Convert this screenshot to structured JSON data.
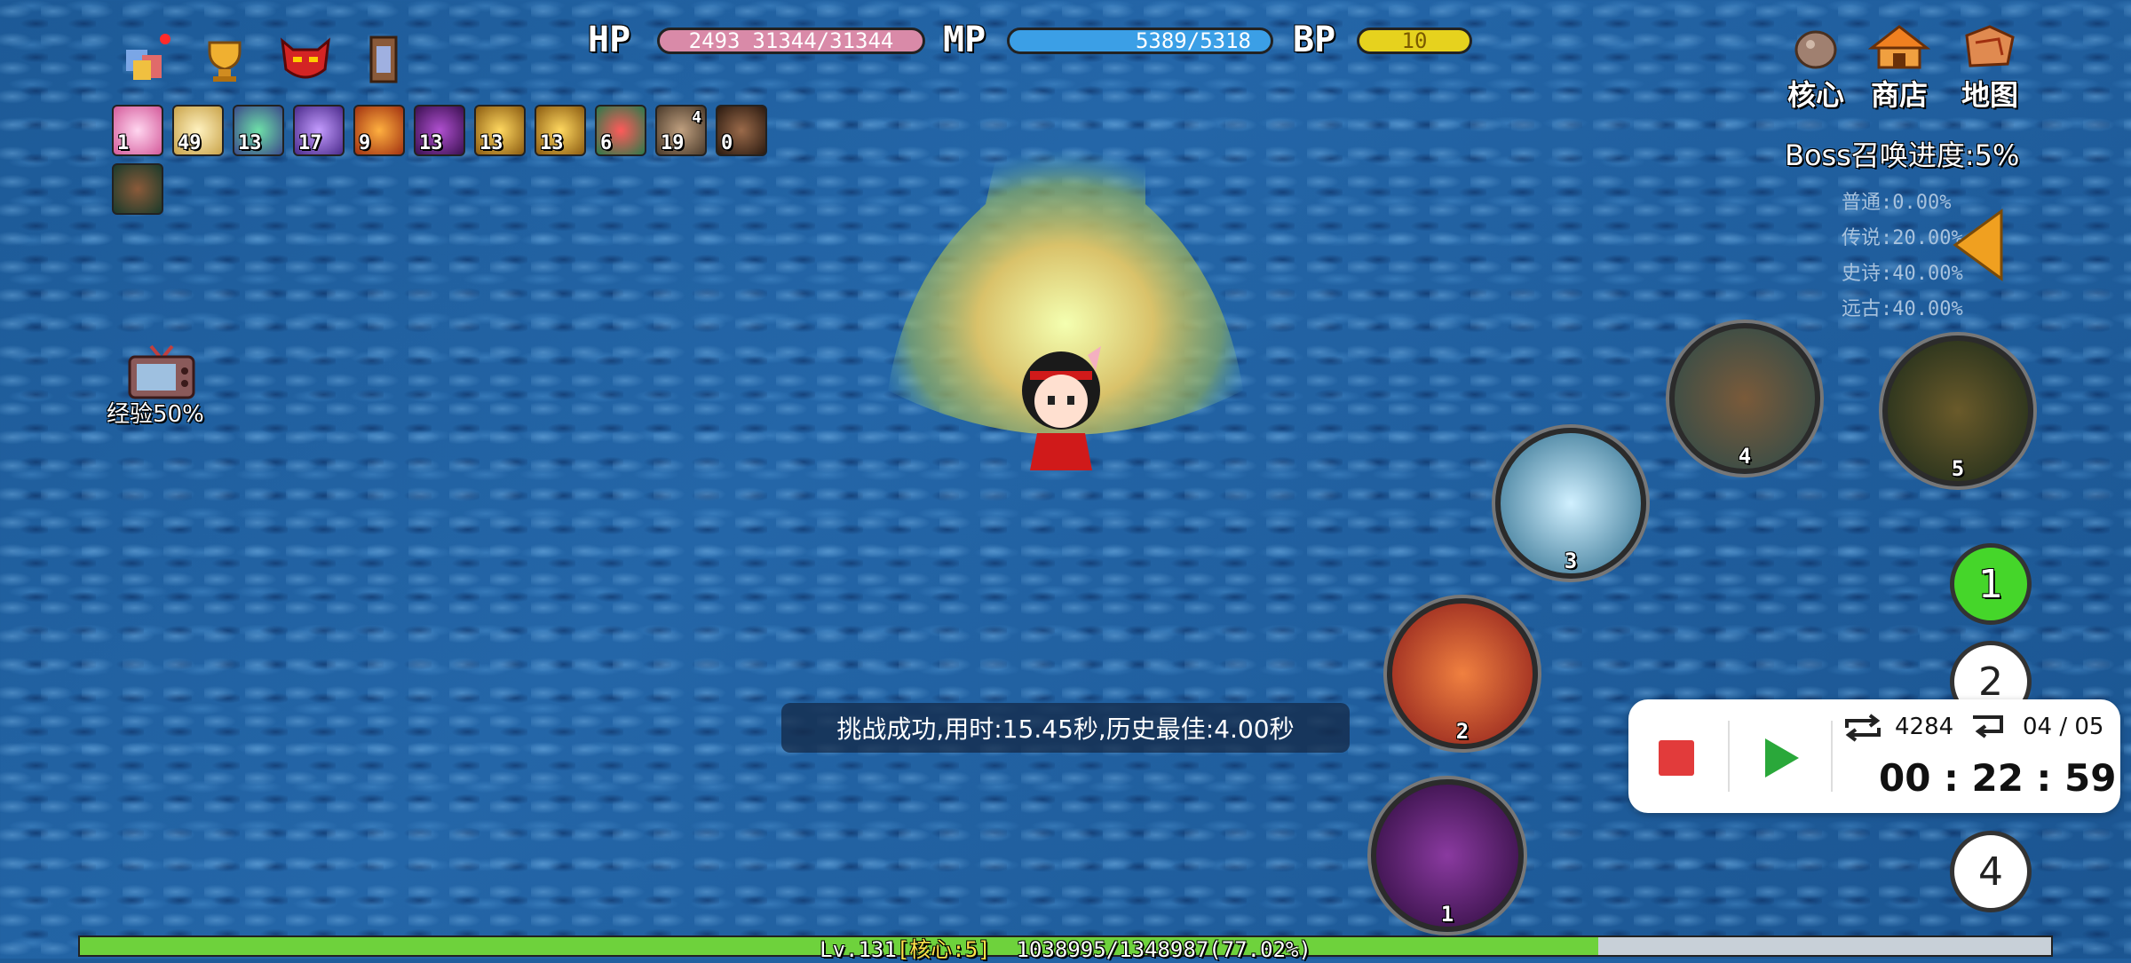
{
  "hud": {
    "hp": {
      "label": "HP",
      "prefix": "2493",
      "text": "31344/31344"
    },
    "mp": {
      "label": "MP",
      "text": "5389/5318"
    },
    "bp": {
      "label": "BP",
      "text": "10"
    }
  },
  "buffs": [
    {
      "count": "1",
      "icon": "spiral-buff-icon"
    },
    {
      "count": "49",
      "icon": "feather-buff-icon"
    },
    {
      "count": "13",
      "icon": "scales-buff-icon"
    },
    {
      "count": "17",
      "icon": "purple-wing-buff-icon"
    },
    {
      "count": "9",
      "icon": "fire-beast-buff-icon"
    },
    {
      "count": "13",
      "icon": "dark-wing-buff-icon"
    },
    {
      "count": "13",
      "icon": "gold-bell-buff-icon"
    },
    {
      "count": "13",
      "icon": "gold-bell-buff-icon"
    },
    {
      "count": "6",
      "icon": "red-flower-buff-icon"
    },
    {
      "count": "19",
      "sup": "4",
      "icon": "pickaxe-buff-icon"
    },
    {
      "count": "0",
      "icon": "werewolf-buff-icon"
    },
    {
      "count": "",
      "icon": "warrior-buff-icon"
    }
  ],
  "exp_bonus": "经验50%",
  "menu": {
    "core": "核心",
    "shop": "商店",
    "map": "地图"
  },
  "boss_progress": "Boss召唤进度:5%",
  "drop_rates": [
    "普通:0.00%",
    "传说:20.00%",
    "史诗:40.00%",
    "远古:40.00%"
  ],
  "skills": [
    {
      "num": "1"
    },
    {
      "num": "2"
    },
    {
      "num": "3"
    },
    {
      "num": "4"
    },
    {
      "num": "5"
    }
  ],
  "slots": [
    "1",
    "2",
    "4"
  ],
  "message": "挑战成功,用时:15.45秒,历史最佳:4.00秒",
  "script_panel": {
    "repeat_count": "4284",
    "step": "04 / 05",
    "timer": "00 : 22 : 59"
  },
  "level_bar": {
    "text_level": "Lv.131",
    "text_core": "[核心:5]",
    "text_exp": "1038995/1348987(77.02%)",
    "progress": 0.7702
  },
  "colors": {
    "hp": "#d98aa8",
    "mp": "#3b9fe6",
    "bp": "#e6d21e",
    "exp": "#6ed23c",
    "slot_active": "#45d62a"
  }
}
